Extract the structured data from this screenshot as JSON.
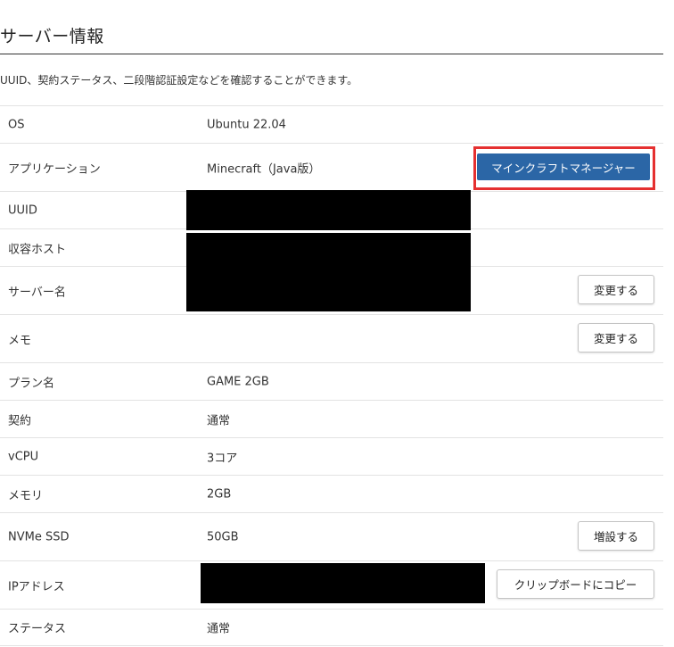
{
  "page": {
    "title": "サーバー情報",
    "description": "UUID、契約ステータス、二段階認証設定などを確認することができます。"
  },
  "rows": [
    {
      "label": "OS",
      "value": "Ubuntu 22.04"
    },
    {
      "label": "アプリケーション",
      "value": "Minecraft（Java版）"
    },
    {
      "label": "UUID",
      "value": ""
    },
    {
      "label": "収容ホスト",
      "value": ""
    },
    {
      "label": "サーバー名",
      "value": ""
    },
    {
      "label": "メモ",
      "value": ""
    },
    {
      "label": "プラン名",
      "value": "GAME 2GB"
    },
    {
      "label": "契約",
      "value": "通常"
    },
    {
      "label": "vCPU",
      "value": "3コア"
    },
    {
      "label": "メモリ",
      "value": "2GB"
    },
    {
      "label": "NVMe SSD",
      "value": "50GB"
    },
    {
      "label": "IPアドレス",
      "value": ""
    },
    {
      "label": "ステータス",
      "value": "通常"
    }
  ],
  "buttons": {
    "minecraft_manager": "マインクラフトマネージャー",
    "change_server_name": "変更する",
    "change_memo": "変更する",
    "increase_ssd": "増設する",
    "copy_ip": "クリップボードにコピー"
  },
  "colors": {
    "primary_button": "#2b66a6",
    "highlight_border": "#e53030"
  }
}
